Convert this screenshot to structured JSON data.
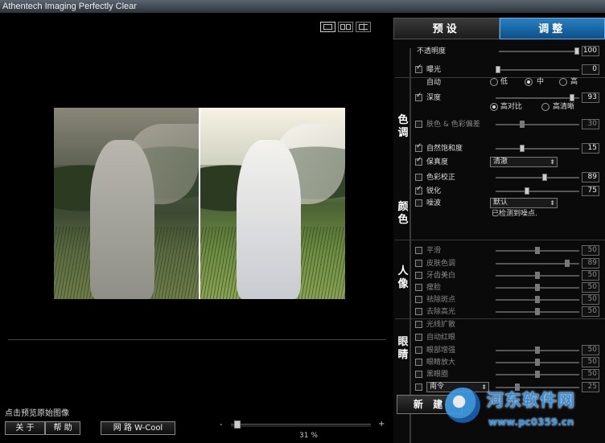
{
  "window": {
    "title": "Athentech Imaging Perfectly Clear"
  },
  "view_buttons": [
    {
      "name": "single-view"
    },
    {
      "name": "side-by-side-view"
    },
    {
      "name": "split-view"
    }
  ],
  "status": {
    "text": "点击预览原始图像"
  },
  "bottom_buttons": {
    "about": "关 于",
    "help": "帮 助",
    "website": "网 路 W-Cool"
  },
  "zoom": {
    "minus": "-",
    "plus": "+",
    "label": "31 %",
    "value_percent": 31
  },
  "tabs": [
    {
      "label": "预设",
      "active": false
    },
    {
      "label": "调整",
      "active": true
    }
  ],
  "sections": {
    "color": "色调",
    "tone": "颜色",
    "portrait": "人像",
    "eyes": "眼睛"
  },
  "adjust": {
    "opacity": {
      "label": "不透明度",
      "value": "100"
    },
    "exposure": {
      "label": "曝光",
      "value": "0",
      "checked": true
    },
    "auto": {
      "label": "自动",
      "options": [
        "低",
        "中",
        "高"
      ],
      "selected": "中"
    },
    "depth": {
      "label": "深度",
      "value": "93",
      "checked": true,
      "options": [
        "高对比",
        "高清晰"
      ],
      "selected": "高对比"
    },
    "skin_color_bias": {
      "label": "肤色 & 色彩偏差",
      "value": "30",
      "checked": false
    },
    "natural_saturation": {
      "label": "自然饱和度",
      "value": "15",
      "checked": true
    },
    "fidelity": {
      "label": "保真度",
      "checked": true,
      "dropdown": "清澈"
    },
    "color_correction": {
      "label": "色彩校正",
      "value": "89",
      "checked": false
    },
    "sharpen": {
      "label": "锐化",
      "value": "75",
      "checked": true
    },
    "noise": {
      "label": "噪波",
      "checked": false,
      "dropdown": "默认",
      "note": "已检测到噪点."
    },
    "smooth": {
      "label": "平滑",
      "value": "50",
      "checked": false
    },
    "skin_tone": {
      "label": "皮肤色调",
      "value": "89",
      "checked": false
    },
    "teeth_whiten": {
      "label": "牙齿美白",
      "value": "50",
      "checked": false
    },
    "face_slim": {
      "label": "瘦脸",
      "value": "50",
      "checked": false
    },
    "remove_blemish": {
      "label": "祛除斑点",
      "value": "50",
      "checked": false
    },
    "remove_shine": {
      "label": "去除高光",
      "value": "50",
      "checked": false
    },
    "ray_expand": {
      "label": "光线扩散",
      "checked": false
    },
    "auto_redeye": {
      "label": "自动红眼",
      "checked": false
    },
    "eye_enhance": {
      "label": "眼部增强",
      "value": "50",
      "checked": false
    },
    "eye_enlarge": {
      "label": "眼睛放大",
      "value": "50",
      "checked": false
    },
    "dark_circles": {
      "label": "黑眼圈",
      "value": "50",
      "checked": false
    },
    "style": {
      "dropdown": "南令",
      "value": "25",
      "checked": false
    }
  },
  "new_button": {
    "label": "新 建"
  },
  "watermark": {
    "title": "河东软件网",
    "url": "www.pc0359.cn"
  }
}
